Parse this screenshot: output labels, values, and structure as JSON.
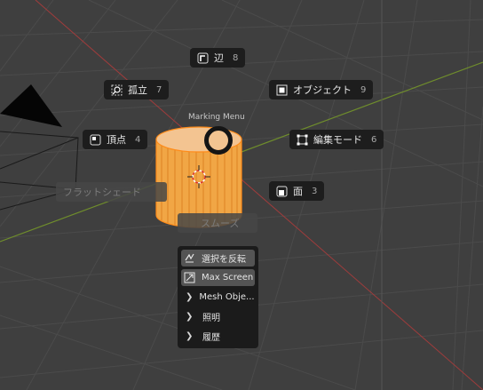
{
  "pie_menu": {
    "title": "Marking Menu",
    "items": [
      {
        "id": "edge",
        "label": "辺",
        "key": "8",
        "icon": "edge-icon"
      },
      {
        "id": "isolate",
        "label": "孤立",
        "key": "7",
        "icon": "isolate-icon"
      },
      {
        "id": "object",
        "label": "オブジェクト",
        "key": "9",
        "icon": "object-mode-icon"
      },
      {
        "id": "vertex",
        "label": "頂点",
        "key": "4",
        "icon": "vertex-icon"
      },
      {
        "id": "editmode",
        "label": "編集モード",
        "key": "6",
        "icon": "edit-mode-icon"
      },
      {
        "id": "face",
        "label": "面",
        "key": "3",
        "icon": "face-icon"
      }
    ]
  },
  "ghost_items": {
    "flat_shade": "フラットシェード",
    "smooth_shade": "スムーズ"
  },
  "context_menu": {
    "items": [
      {
        "label": "選択を反転",
        "type": "button",
        "icon": "invert-selection-icon"
      },
      {
        "label": "Max Screen",
        "type": "button",
        "icon": "maximize-icon"
      },
      {
        "label": "Mesh Obje...",
        "type": "submenu"
      },
      {
        "label": "照明",
        "type": "submenu"
      },
      {
        "label": "履歴",
        "type": "submenu"
      }
    ]
  },
  "colors": {
    "viewport_bg": "#3f3f3f",
    "grid_line": "#4a4a4a",
    "x_axis": "#9a3a3a",
    "y_axis": "#6a8a2a",
    "cylinder": "#f0a040",
    "selected_edge": "#ff8c1a",
    "menu_bg": "#1b1b1b",
    "button_bg": "#545454"
  }
}
